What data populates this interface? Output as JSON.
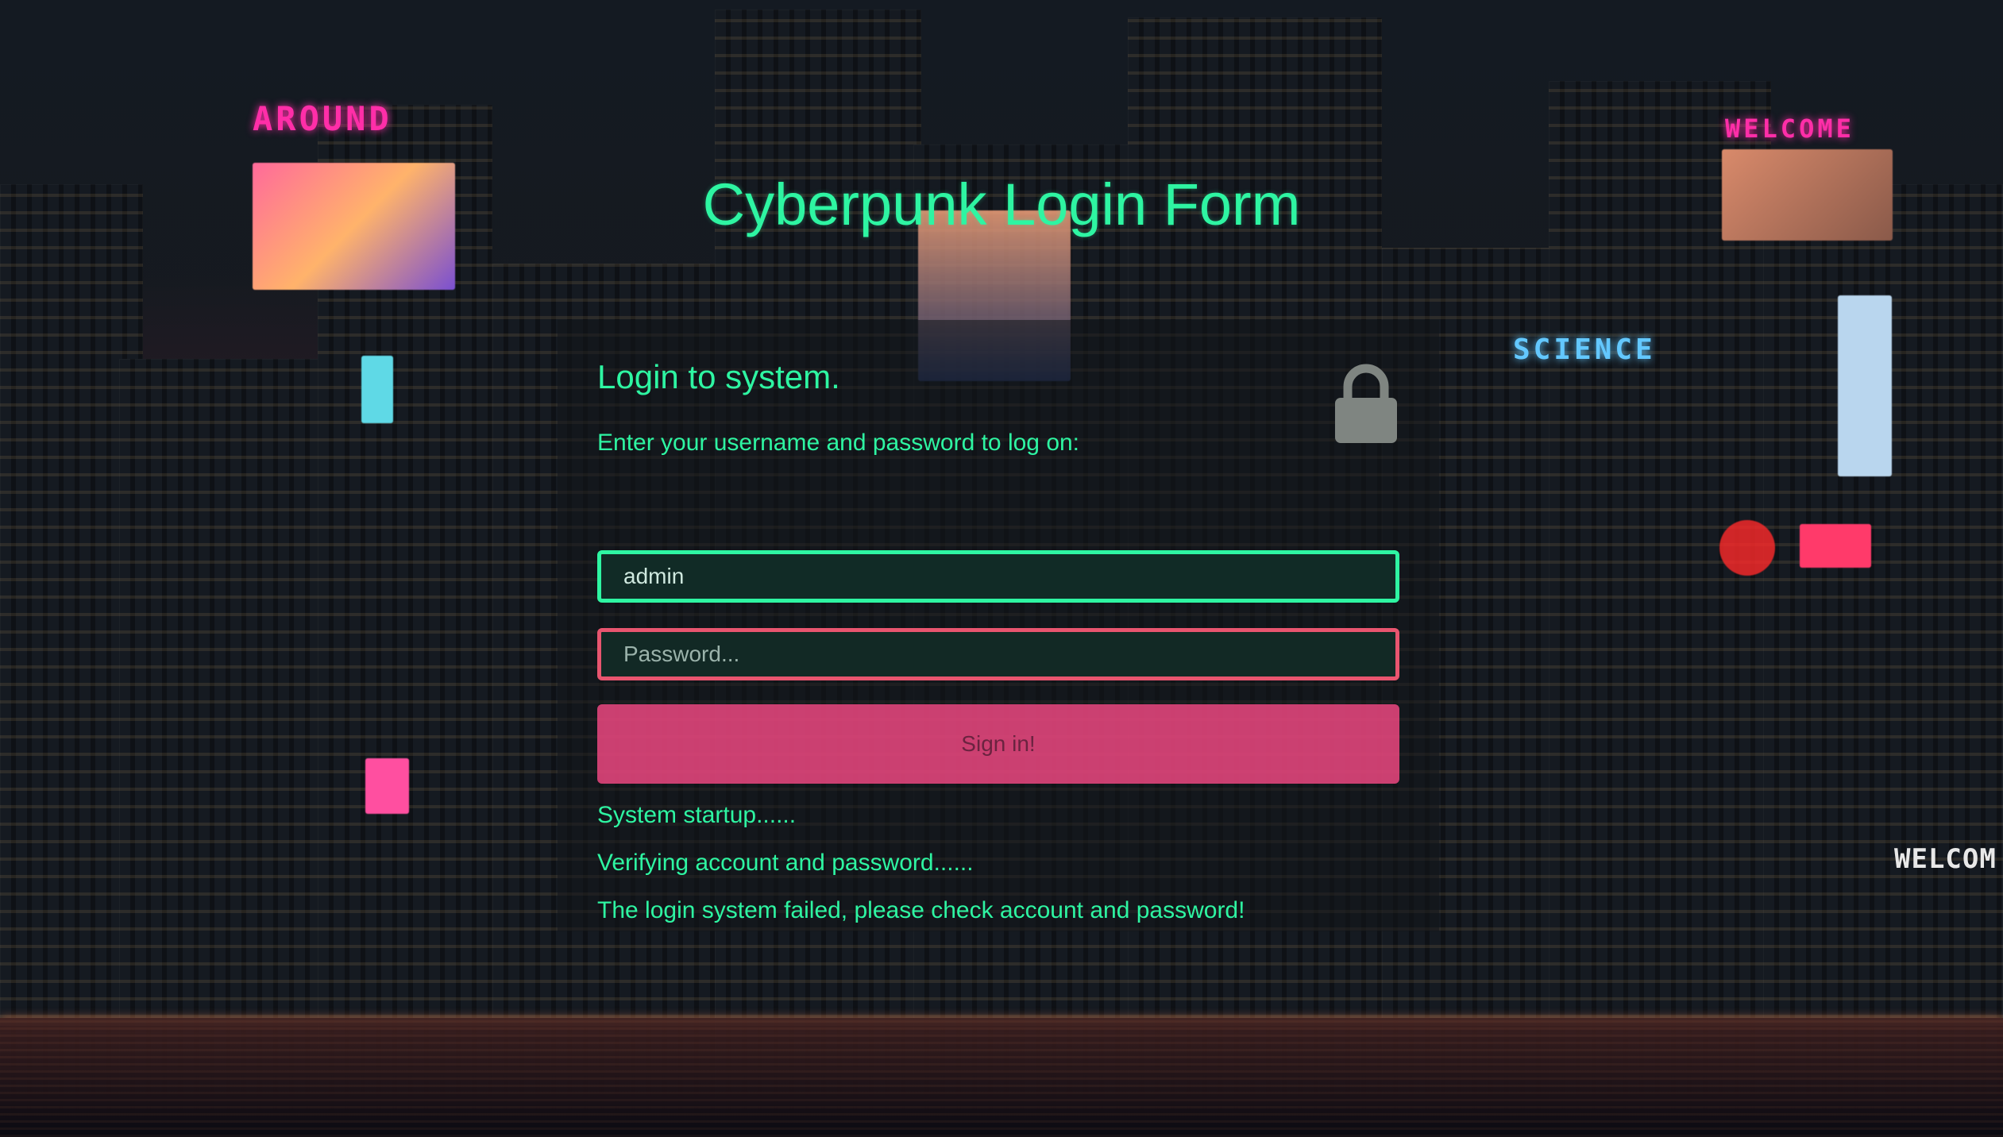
{
  "page": {
    "title": "Cyberpunk Login Form"
  },
  "panel": {
    "title": "Login to system.",
    "subtitle": "Enter your username and password to log on:",
    "username_value": "admin",
    "password_placeholder": "Password...",
    "signin_label": "Sign in!",
    "log": [
      "System startup......",
      "Verifying account and password......",
      "The login system failed, please check account and password!"
    ]
  },
  "background_signs": {
    "around": "AROUND",
    "welcome": "WELCOME",
    "science": "SCIENCE",
    "welcome_right": "WELCOM"
  },
  "colors": {
    "accent_green": "#2ef5a2",
    "accent_pink": "#ec4880",
    "error_border": "#e8556f"
  },
  "icons": {
    "lock": "lock-icon"
  }
}
